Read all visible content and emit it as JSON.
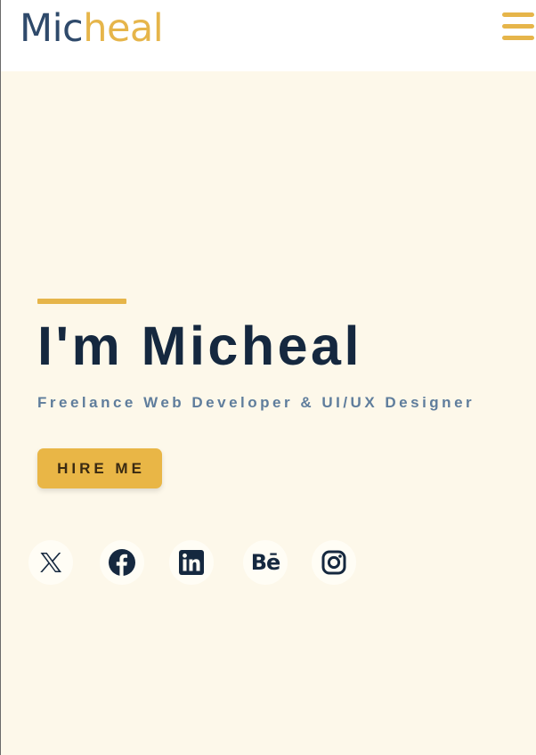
{
  "header": {
    "logo_part1": "Mic",
    "logo_part2": "heal",
    "menu_icon": "hamburger-menu-icon"
  },
  "hero": {
    "title": "I'm Micheal",
    "subtitle": "Freelance Web Developer & UI/UX Designer",
    "cta_label": "HIRE ME",
    "social_links": [
      {
        "name": "x-twitter",
        "icon": "x-twitter-icon"
      },
      {
        "name": "facebook",
        "icon": "facebook-icon"
      },
      {
        "name": "linkedin",
        "icon": "linkedin-icon"
      },
      {
        "name": "behance",
        "icon": "behance-icon",
        "glyph": "Bē"
      },
      {
        "name": "instagram",
        "icon": "instagram-icon"
      }
    ]
  },
  "colors": {
    "accent": "#e6b54a",
    "navy": "#15283f",
    "hero_background": "#fdf8ea",
    "subtitle": "#5f7d9c"
  }
}
